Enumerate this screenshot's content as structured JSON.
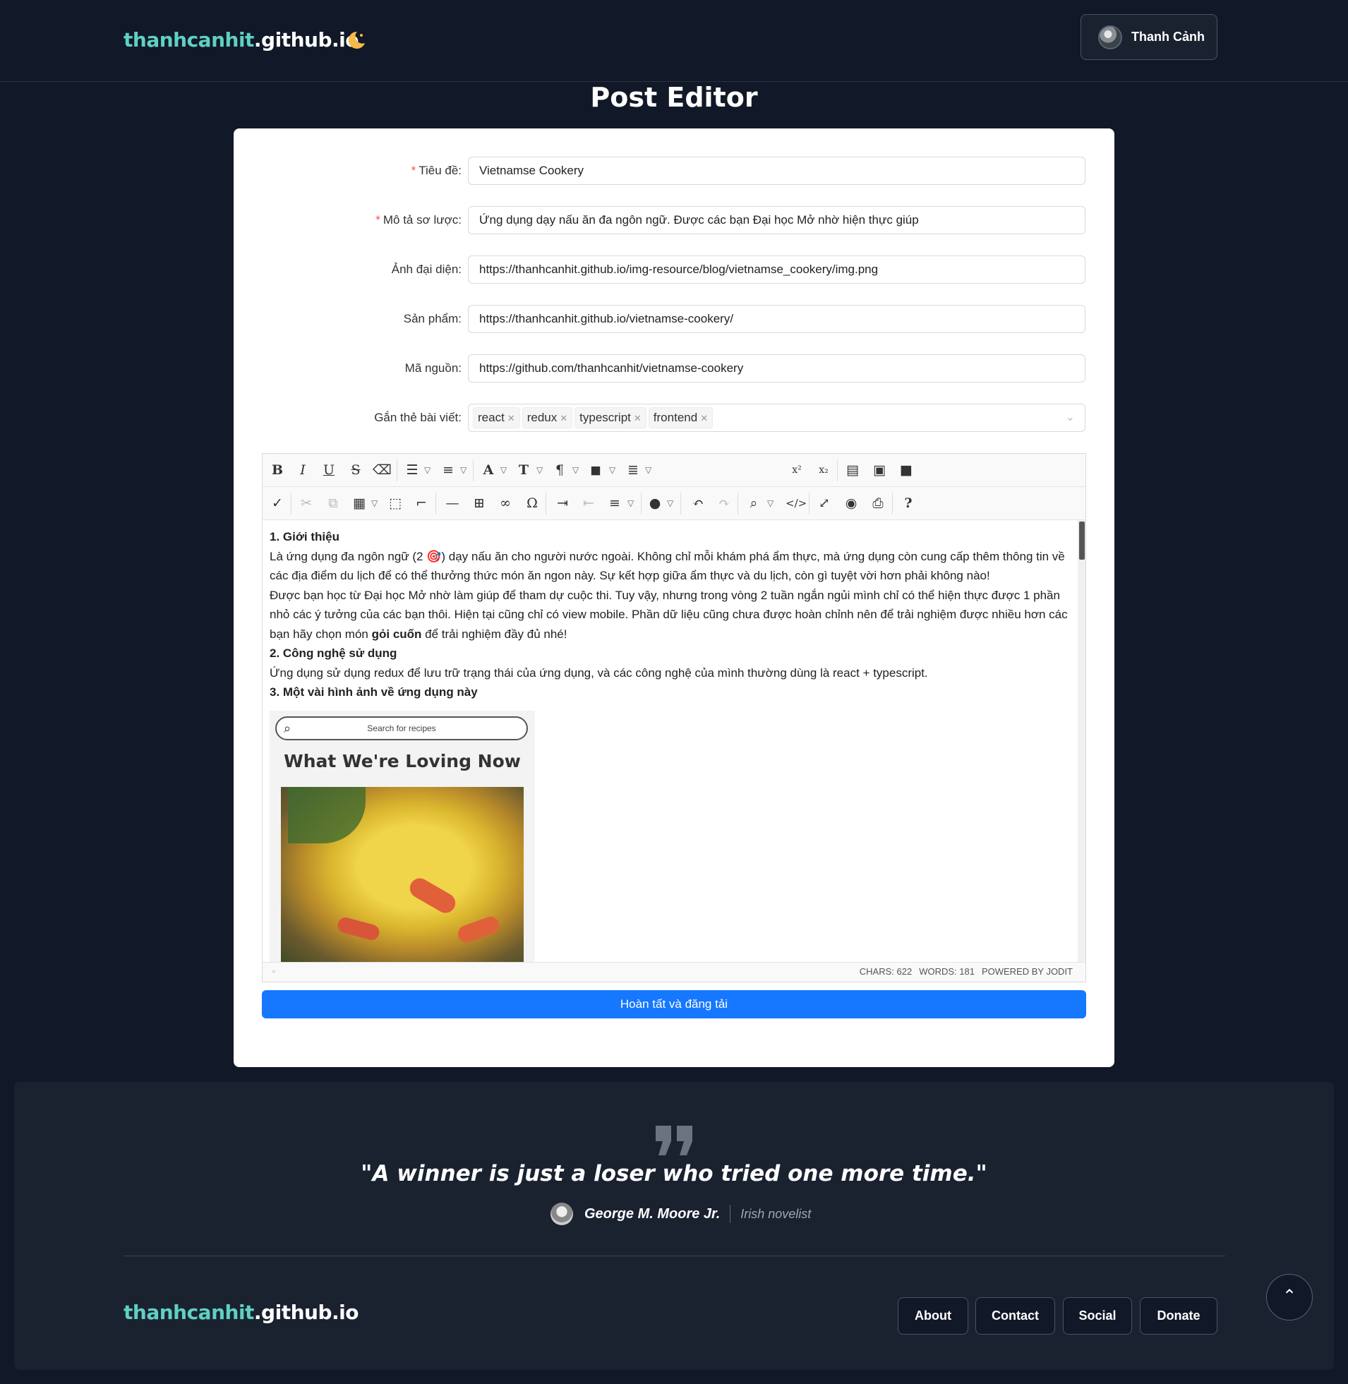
{
  "header": {
    "logo_a": "thanhcanhit",
    "logo_b": ".github.io",
    "user_name": "Thanh Cảnh"
  },
  "page_title": "Post Editor",
  "form": {
    "title_label": "Tiêu đề:",
    "title_value": "Vietnamse Cookery",
    "desc_label": "Mô tả sơ lược:",
    "desc_value": "Ứng dụng dạy nấu ăn đa ngôn ngữ. Được các bạn Đại học Mở nhờ hiện thực giúp",
    "avatar_label": "Ảnh đại diện:",
    "avatar_value": "https://thanhcanhit.github.io/img-resource/blog/vietnamse_cookery/img.png",
    "product_label": "Sản phẩm:",
    "product_value": "https://thanhcanhit.github.io/vietnamse-cookery/",
    "source_label": "Mã nguồn:",
    "source_value": "https://github.com/thanhcanhit/vietnamse-cookery",
    "tags_label": "Gắn thẻ bài viết:",
    "tags": [
      "react",
      "redux",
      "typescript",
      "frontend"
    ]
  },
  "editor": {
    "h1": "1. Giới thiệu",
    "p1a": "Là ứng dụng đa ngôn ngữ (2 🎯) dạy nấu ăn cho người nước ngoài. Không chỉ mỗi khám phá ẩm thực, mà ứng dụng còn cung cấp thêm thông tin về các địa điểm du lịch để có thể thưởng thức món ăn ngon này. Sự kết hợp giữa ẩm thực và du lịch, còn gì tuyệt vời hơn phải không nào!",
    "p1b": "Được bạn học từ Đại học Mở nhờ làm giúp để tham dự cuộc thi. Tuy vậy, nhưng trong vòng 2 tuần ngắn ngủi mình chỉ có thể hiện thực được 1 phần nhỏ các ý tưởng của các bạn thôi. Hiện tại cũng chỉ có view mobile. Phần dữ liệu cũng chưa được hoàn chỉnh nên để trải nghiệm được nhiều hơn các bạn hãy chọn món ",
    "p1b_bold": "gỏi cuốn",
    "p1b_end": " để trải nghiệm đầy đủ nhé!",
    "h2": "2. Công nghệ sử dụng",
    "p2": "Ứng dụng sử dụng redux để lưu trữ trạng thái của ứng dụng, và các công nghệ của mình thường dùng là react + typescript.",
    "h3": "3. Một vài hình ảnh về ứng dụng này",
    "img_search": "Search for recipes",
    "img_heading": "What We're Loving Now",
    "chars": "CHARS: 622",
    "words": "WORDS: 181",
    "powered": "POWERED BY JODIT"
  },
  "submit_label": "Hoàn tất và đăng tải",
  "footer": {
    "quote": "\"A winner is just a loser who tried one more time.\"",
    "author": "George M. Moore Jr.",
    "role": "Irish novelist",
    "logo_a": "thanhcanhit",
    "logo_b": ".github.io",
    "links": [
      "About",
      "Contact",
      "Social",
      "Donate"
    ]
  },
  "colors": {
    "bg": "#111827",
    "accent": "#5fd0c4",
    "primary": "#1677ff",
    "moon": "#f6b94a"
  }
}
